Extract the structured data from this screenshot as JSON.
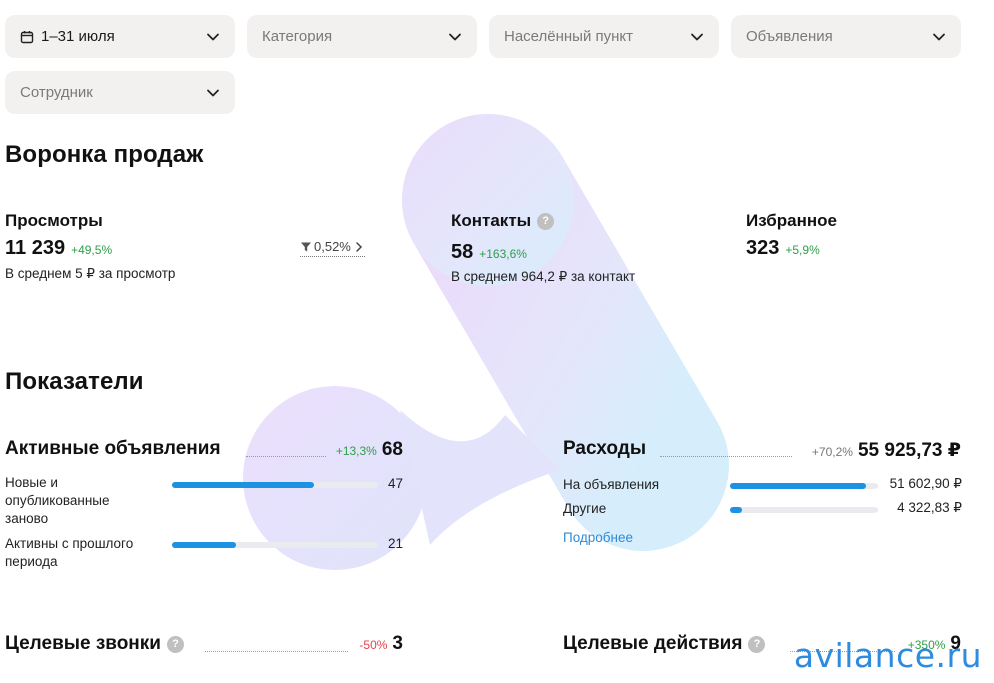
{
  "filters": {
    "date": "1–31 июля",
    "category": "Категория",
    "locality": "Населённый пункт",
    "ads": "Объявления",
    "employee": "Сотрудник"
  },
  "funnel": {
    "title": "Воронка продаж",
    "views": {
      "label": "Просмотры",
      "value": "11 239",
      "delta": "+49,5%",
      "sub": "В среднем 5 ₽ за просмотр"
    },
    "conversion": "0,52%",
    "contacts": {
      "label": "Контакты",
      "value": "58",
      "delta": "+163,6%",
      "sub": "В среднем 964,2 ₽ за контакт"
    },
    "favorites": {
      "label": "Избранное",
      "value": "323",
      "delta": "+5,9%"
    }
  },
  "indicators": {
    "title": "Показатели",
    "active": {
      "title": "Активные объявления",
      "delta": "+13,3%",
      "value": "68",
      "rows": [
        {
          "label": "Новые и опубликованные заново",
          "value": "47",
          "fraction": 0.69
        },
        {
          "label": "Активны с прошлого периода",
          "value": "21",
          "fraction": 0.31
        }
      ]
    },
    "expenses": {
      "title": "Расходы",
      "delta": "+70,2%",
      "value": "55 925,73 ₽",
      "rows": [
        {
          "label": "На объявления",
          "value": "51 602,90 ₽",
          "fraction": 0.92
        },
        {
          "label": "Другие",
          "value": "4 322,83 ₽",
          "fraction": 0.08
        }
      ],
      "more": "Подробнее"
    },
    "calls": {
      "title": "Целевые звонки",
      "delta": "-50%",
      "value": "3"
    },
    "actions": {
      "title": "Целевые действия",
      "delta": "+350%",
      "value": "9"
    }
  },
  "watermark": "avilance.ru",
  "colors": {
    "accent": "#1d92e3",
    "positive": "#2e9e49",
    "negative": "#e5414d",
    "link": "#2f8ad6"
  }
}
